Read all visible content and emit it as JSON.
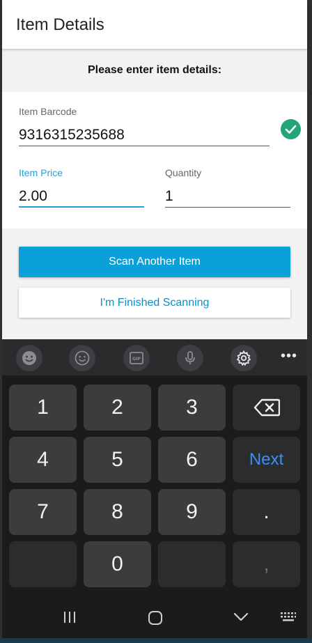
{
  "header": {
    "title": "Item Details"
  },
  "prompt": "Please enter item details:",
  "form": {
    "barcode": {
      "label": "Item Barcode",
      "value": "9316315235688",
      "status_icon": "check-circle-icon"
    },
    "price": {
      "label": "Item Price",
      "value": "2.00"
    },
    "quantity": {
      "label": "Quantity",
      "value": "1"
    }
  },
  "actions": {
    "scan_another": "Scan Another Item",
    "finished": "I'm Finished Scanning"
  },
  "keyboard": {
    "toolbar": [
      "emoji-face-icon",
      "smiley-icon",
      "gif-icon",
      "microphone-icon",
      "settings-gear-icon",
      "more-icon"
    ],
    "keys": {
      "k1": "1",
      "k2": "2",
      "k3": "3",
      "k4": "4",
      "k5": "5",
      "k6": "6",
      "k7": "7",
      "k8": "8",
      "k9": "9",
      "k0": "0",
      "next": "Next",
      "dot": ".",
      "comma": ","
    }
  },
  "nav": [
    "recent-apps-icon",
    "home-icon",
    "back-icon",
    "keyboard-icon"
  ],
  "colors": {
    "accent": "#0ca0d8",
    "success": "#23a47a",
    "next_key": "#3d8ef0",
    "keyboard_bg": "#1b1b1c"
  }
}
